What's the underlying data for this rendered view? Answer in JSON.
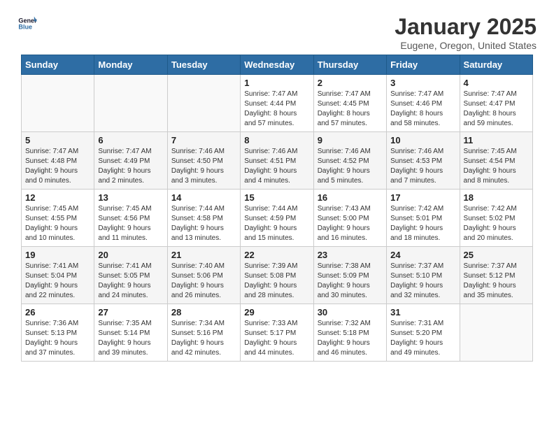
{
  "header": {
    "logo_line1": "General",
    "logo_line2": "Blue",
    "month": "January 2025",
    "location": "Eugene, Oregon, United States"
  },
  "weekdays": [
    "Sunday",
    "Monday",
    "Tuesday",
    "Wednesday",
    "Thursday",
    "Friday",
    "Saturday"
  ],
  "weeks": [
    [
      {
        "day": "",
        "sunrise": "",
        "sunset": "",
        "daylight": ""
      },
      {
        "day": "",
        "sunrise": "",
        "sunset": "",
        "daylight": ""
      },
      {
        "day": "",
        "sunrise": "",
        "sunset": "",
        "daylight": ""
      },
      {
        "day": "1",
        "sunrise": "Sunrise: 7:47 AM",
        "sunset": "Sunset: 4:44 PM",
        "daylight": "Daylight: 8 hours and 57 minutes."
      },
      {
        "day": "2",
        "sunrise": "Sunrise: 7:47 AM",
        "sunset": "Sunset: 4:45 PM",
        "daylight": "Daylight: 8 hours and 57 minutes."
      },
      {
        "day": "3",
        "sunrise": "Sunrise: 7:47 AM",
        "sunset": "Sunset: 4:46 PM",
        "daylight": "Daylight: 8 hours and 58 minutes."
      },
      {
        "day": "4",
        "sunrise": "Sunrise: 7:47 AM",
        "sunset": "Sunset: 4:47 PM",
        "daylight": "Daylight: 8 hours and 59 minutes."
      }
    ],
    [
      {
        "day": "5",
        "sunrise": "Sunrise: 7:47 AM",
        "sunset": "Sunset: 4:48 PM",
        "daylight": "Daylight: 9 hours and 0 minutes."
      },
      {
        "day": "6",
        "sunrise": "Sunrise: 7:47 AM",
        "sunset": "Sunset: 4:49 PM",
        "daylight": "Daylight: 9 hours and 2 minutes."
      },
      {
        "day": "7",
        "sunrise": "Sunrise: 7:46 AM",
        "sunset": "Sunset: 4:50 PM",
        "daylight": "Daylight: 9 hours and 3 minutes."
      },
      {
        "day": "8",
        "sunrise": "Sunrise: 7:46 AM",
        "sunset": "Sunset: 4:51 PM",
        "daylight": "Daylight: 9 hours and 4 minutes."
      },
      {
        "day": "9",
        "sunrise": "Sunrise: 7:46 AM",
        "sunset": "Sunset: 4:52 PM",
        "daylight": "Daylight: 9 hours and 5 minutes."
      },
      {
        "day": "10",
        "sunrise": "Sunrise: 7:46 AM",
        "sunset": "Sunset: 4:53 PM",
        "daylight": "Daylight: 9 hours and 7 minutes."
      },
      {
        "day": "11",
        "sunrise": "Sunrise: 7:45 AM",
        "sunset": "Sunset: 4:54 PM",
        "daylight": "Daylight: 9 hours and 8 minutes."
      }
    ],
    [
      {
        "day": "12",
        "sunrise": "Sunrise: 7:45 AM",
        "sunset": "Sunset: 4:55 PM",
        "daylight": "Daylight: 9 hours and 10 minutes."
      },
      {
        "day": "13",
        "sunrise": "Sunrise: 7:45 AM",
        "sunset": "Sunset: 4:56 PM",
        "daylight": "Daylight: 9 hours and 11 minutes."
      },
      {
        "day": "14",
        "sunrise": "Sunrise: 7:44 AM",
        "sunset": "Sunset: 4:58 PM",
        "daylight": "Daylight: 9 hours and 13 minutes."
      },
      {
        "day": "15",
        "sunrise": "Sunrise: 7:44 AM",
        "sunset": "Sunset: 4:59 PM",
        "daylight": "Daylight: 9 hours and 15 minutes."
      },
      {
        "day": "16",
        "sunrise": "Sunrise: 7:43 AM",
        "sunset": "Sunset: 5:00 PM",
        "daylight": "Daylight: 9 hours and 16 minutes."
      },
      {
        "day": "17",
        "sunrise": "Sunrise: 7:42 AM",
        "sunset": "Sunset: 5:01 PM",
        "daylight": "Daylight: 9 hours and 18 minutes."
      },
      {
        "day": "18",
        "sunrise": "Sunrise: 7:42 AM",
        "sunset": "Sunset: 5:02 PM",
        "daylight": "Daylight: 9 hours and 20 minutes."
      }
    ],
    [
      {
        "day": "19",
        "sunrise": "Sunrise: 7:41 AM",
        "sunset": "Sunset: 5:04 PM",
        "daylight": "Daylight: 9 hours and 22 minutes."
      },
      {
        "day": "20",
        "sunrise": "Sunrise: 7:41 AM",
        "sunset": "Sunset: 5:05 PM",
        "daylight": "Daylight: 9 hours and 24 minutes."
      },
      {
        "day": "21",
        "sunrise": "Sunrise: 7:40 AM",
        "sunset": "Sunset: 5:06 PM",
        "daylight": "Daylight: 9 hours and 26 minutes."
      },
      {
        "day": "22",
        "sunrise": "Sunrise: 7:39 AM",
        "sunset": "Sunset: 5:08 PM",
        "daylight": "Daylight: 9 hours and 28 minutes."
      },
      {
        "day": "23",
        "sunrise": "Sunrise: 7:38 AM",
        "sunset": "Sunset: 5:09 PM",
        "daylight": "Daylight: 9 hours and 30 minutes."
      },
      {
        "day": "24",
        "sunrise": "Sunrise: 7:37 AM",
        "sunset": "Sunset: 5:10 PM",
        "daylight": "Daylight: 9 hours and 32 minutes."
      },
      {
        "day": "25",
        "sunrise": "Sunrise: 7:37 AM",
        "sunset": "Sunset: 5:12 PM",
        "daylight": "Daylight: 9 hours and 35 minutes."
      }
    ],
    [
      {
        "day": "26",
        "sunrise": "Sunrise: 7:36 AM",
        "sunset": "Sunset: 5:13 PM",
        "daylight": "Daylight: 9 hours and 37 minutes."
      },
      {
        "day": "27",
        "sunrise": "Sunrise: 7:35 AM",
        "sunset": "Sunset: 5:14 PM",
        "daylight": "Daylight: 9 hours and 39 minutes."
      },
      {
        "day": "28",
        "sunrise": "Sunrise: 7:34 AM",
        "sunset": "Sunset: 5:16 PM",
        "daylight": "Daylight: 9 hours and 42 minutes."
      },
      {
        "day": "29",
        "sunrise": "Sunrise: 7:33 AM",
        "sunset": "Sunset: 5:17 PM",
        "daylight": "Daylight: 9 hours and 44 minutes."
      },
      {
        "day": "30",
        "sunrise": "Sunrise: 7:32 AM",
        "sunset": "Sunset: 5:18 PM",
        "daylight": "Daylight: 9 hours and 46 minutes."
      },
      {
        "day": "31",
        "sunrise": "Sunrise: 7:31 AM",
        "sunset": "Sunset: 5:20 PM",
        "daylight": "Daylight: 9 hours and 49 minutes."
      },
      {
        "day": "",
        "sunrise": "",
        "sunset": "",
        "daylight": ""
      }
    ]
  ]
}
